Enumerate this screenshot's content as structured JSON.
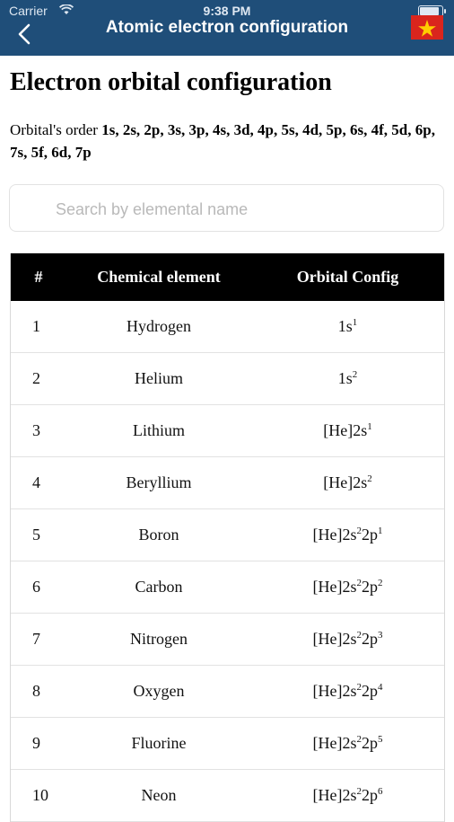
{
  "status_bar": {
    "carrier": "Carrier",
    "time": "9:38 PM"
  },
  "nav": {
    "title": "Atomic electron configuration",
    "back_icon": "chevron-left-icon",
    "flag_icon": "vietnam-flag-icon"
  },
  "header": {
    "title": "Electron orbital configuration",
    "order_label": "Orbital's order",
    "order_sequence": "1s, 2s, 2p, 3s, 3p, 4s, 3d, 4p, 5s, 4d, 5p, 6s, 4f, 5d, 6p, 7s, 5f, 6d, 7p"
  },
  "search": {
    "placeholder": "Search by elemental name",
    "value": ""
  },
  "table": {
    "columns": [
      "#",
      "Chemical element",
      "Orbital Config"
    ],
    "rows": [
      {
        "num": "1",
        "element": "Hydrogen",
        "config": [
          [
            "1s",
            "1"
          ]
        ]
      },
      {
        "num": "2",
        "element": "Helium",
        "config": [
          [
            "1s",
            "2"
          ]
        ]
      },
      {
        "num": "3",
        "element": "Lithium",
        "config": [
          [
            "[He]2s",
            "1"
          ]
        ]
      },
      {
        "num": "4",
        "element": "Beryllium",
        "config": [
          [
            "[He]2s",
            "2"
          ]
        ]
      },
      {
        "num": "5",
        "element": "Boron",
        "config": [
          [
            "[He]2s",
            "2"
          ],
          [
            "2p",
            "1"
          ]
        ]
      },
      {
        "num": "6",
        "element": "Carbon",
        "config": [
          [
            "[He]2s",
            "2"
          ],
          [
            "2p",
            "2"
          ]
        ]
      },
      {
        "num": "7",
        "element": "Nitrogen",
        "config": [
          [
            "[He]2s",
            "2"
          ],
          [
            "2p",
            "3"
          ]
        ]
      },
      {
        "num": "8",
        "element": "Oxygen",
        "config": [
          [
            "[He]2s",
            "2"
          ],
          [
            "2p",
            "4"
          ]
        ]
      },
      {
        "num": "9",
        "element": "Fluorine",
        "config": [
          [
            "[He]2s",
            "2"
          ],
          [
            "2p",
            "5"
          ]
        ]
      },
      {
        "num": "10",
        "element": "Neon",
        "config": [
          [
            "[He]2s",
            "2"
          ],
          [
            "2p",
            "6"
          ]
        ]
      }
    ]
  },
  "colors": {
    "nav_bar": "#1f4e79",
    "table_header": "#000000",
    "flag_red": "#da251d",
    "flag_star": "#ffcd00"
  }
}
